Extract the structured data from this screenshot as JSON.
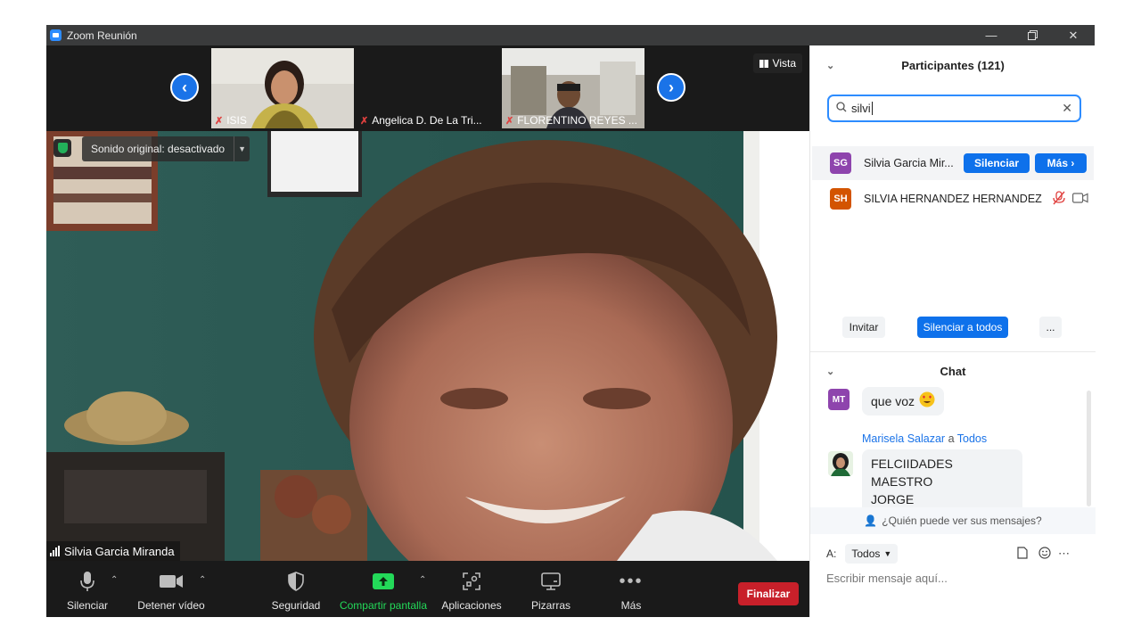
{
  "window": {
    "title": "Zoom Reunión",
    "minimize_icon": "minimize-icon",
    "restore_icon": "restore-icon",
    "close_icon": "close-icon"
  },
  "strip": {
    "prev_icon": "chevron-left-icon",
    "next_icon": "chevron-right-icon",
    "vista_label": "Vista",
    "thumbnails": [
      {
        "name": "ISIS",
        "muted": true
      },
      {
        "name": "Angelica D. De La Tri...",
        "muted": true
      },
      {
        "name": "FLORENTINO REYES ...",
        "muted": true
      }
    ]
  },
  "main_video": {
    "audio_label": "Sonido original: desactivado",
    "speaker_name": "Silvia Garcia Miranda"
  },
  "toolbar": {
    "mute_label": "Silenciar",
    "video_label": "Detener vídeo",
    "security_label": "Seguridad",
    "share_label": "Compartir pantalla",
    "apps_label": "Aplicaciones",
    "whiteboard_label": "Pizarras",
    "more_label": "Más",
    "end_label": "Finalizar",
    "share_color": "#23d959",
    "end_color": "#c8202a"
  },
  "participants": {
    "title": "Participantes (121)",
    "search_value": "silvi",
    "rows": [
      {
        "initials": "SG",
        "name": "Silvia Garcia Mir...",
        "color": "#8e44ad",
        "mute_label": "Silenciar",
        "more_label": "Más ›"
      },
      {
        "initials": "SH",
        "name": "SILVIA HERNANDEZ HERNANDEZ",
        "color": "#d35400"
      }
    ],
    "invite_label": "Invitar",
    "mute_all_label": "Silenciar a todos",
    "more_label": "..."
  },
  "chat": {
    "title": "Chat",
    "messages": [
      {
        "avatar": "MT",
        "avatar_color": "#8e44ad",
        "text": "que voz"
      },
      {
        "sender": "Marisela Salazar",
        "connector": "a",
        "recipient": "Todos",
        "text_line1": "FELCIIDADES MAESTRO",
        "text_line2": "JORGE"
      }
    ],
    "who_can_see": "¿Quién puede ver sus mensajes?",
    "to_label": "A:",
    "to_value": "Todos",
    "placeholder": "Escribir mensaje aquí..."
  }
}
